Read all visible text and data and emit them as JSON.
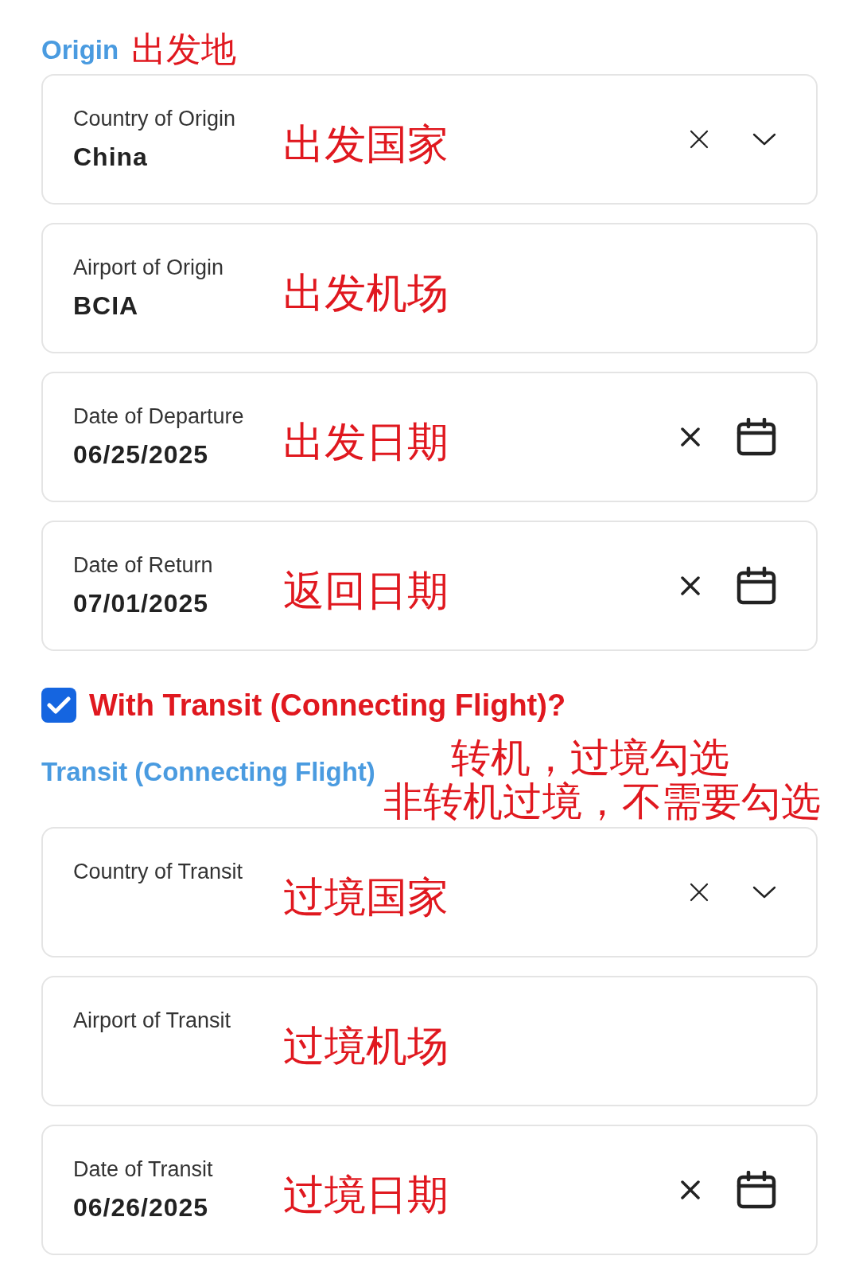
{
  "origin": {
    "heading": "Origin",
    "annotation": "出发地",
    "fields": [
      {
        "kind": "select",
        "label": "Country of Origin",
        "value": "China",
        "annotation": "出发国家"
      },
      {
        "kind": "text",
        "label": "Airport of Origin",
        "value": "BCIA",
        "annotation": "出发机场"
      },
      {
        "kind": "date",
        "label": "Date of Departure",
        "value": "06/25/2025",
        "annotation": "出发日期"
      },
      {
        "kind": "date",
        "label": "Date of Return",
        "value": "07/01/2025",
        "annotation": "返回日期"
      }
    ]
  },
  "transit_checkbox": {
    "label": "With Transit (Connecting Flight)?",
    "checked": true
  },
  "transit": {
    "heading": "Transit (Connecting Flight)",
    "annotations": [
      "转机，过境勾选",
      "非转机过境，不需要勾选"
    ],
    "fields": [
      {
        "kind": "select",
        "label": "Country of Transit",
        "annotation": "过境国家"
      },
      {
        "kind": "text",
        "label": "Airport of Transit",
        "annotation": "过境机场"
      },
      {
        "kind": "date",
        "label": "Date of Transit",
        "value": "06/26/2025",
        "annotation": "过境日期"
      }
    ]
  }
}
